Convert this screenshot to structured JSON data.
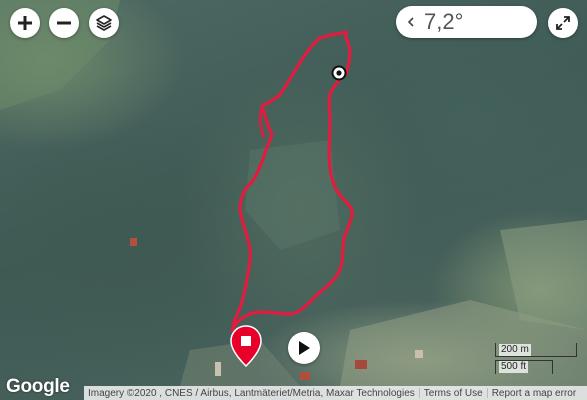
{
  "controls": {
    "zoom_in_icon": "plus-icon",
    "zoom_out_icon": "minus-icon",
    "layers_icon": "layers-icon",
    "expand_icon": "expand-arrows-icon"
  },
  "weather": {
    "temperature": "7,2°",
    "collapse_icon": "chevron-left-icon"
  },
  "route": {
    "color": "#e31b3f",
    "start_marker": "black-dot-marker",
    "end_marker_icon": "stop-square-icon",
    "end_marker_color": "#e8002a"
  },
  "player": {
    "play_icon": "play-icon"
  },
  "scale": {
    "metric": "200 m",
    "imperial": "500 ft"
  },
  "footer": {
    "logo": "Google",
    "imagery": "Imagery ©2020 , CNES / Airbus, Lantmäteriet/Metria, Maxar Technologies",
    "terms": "Terms of Use",
    "report": "Report a map error"
  }
}
